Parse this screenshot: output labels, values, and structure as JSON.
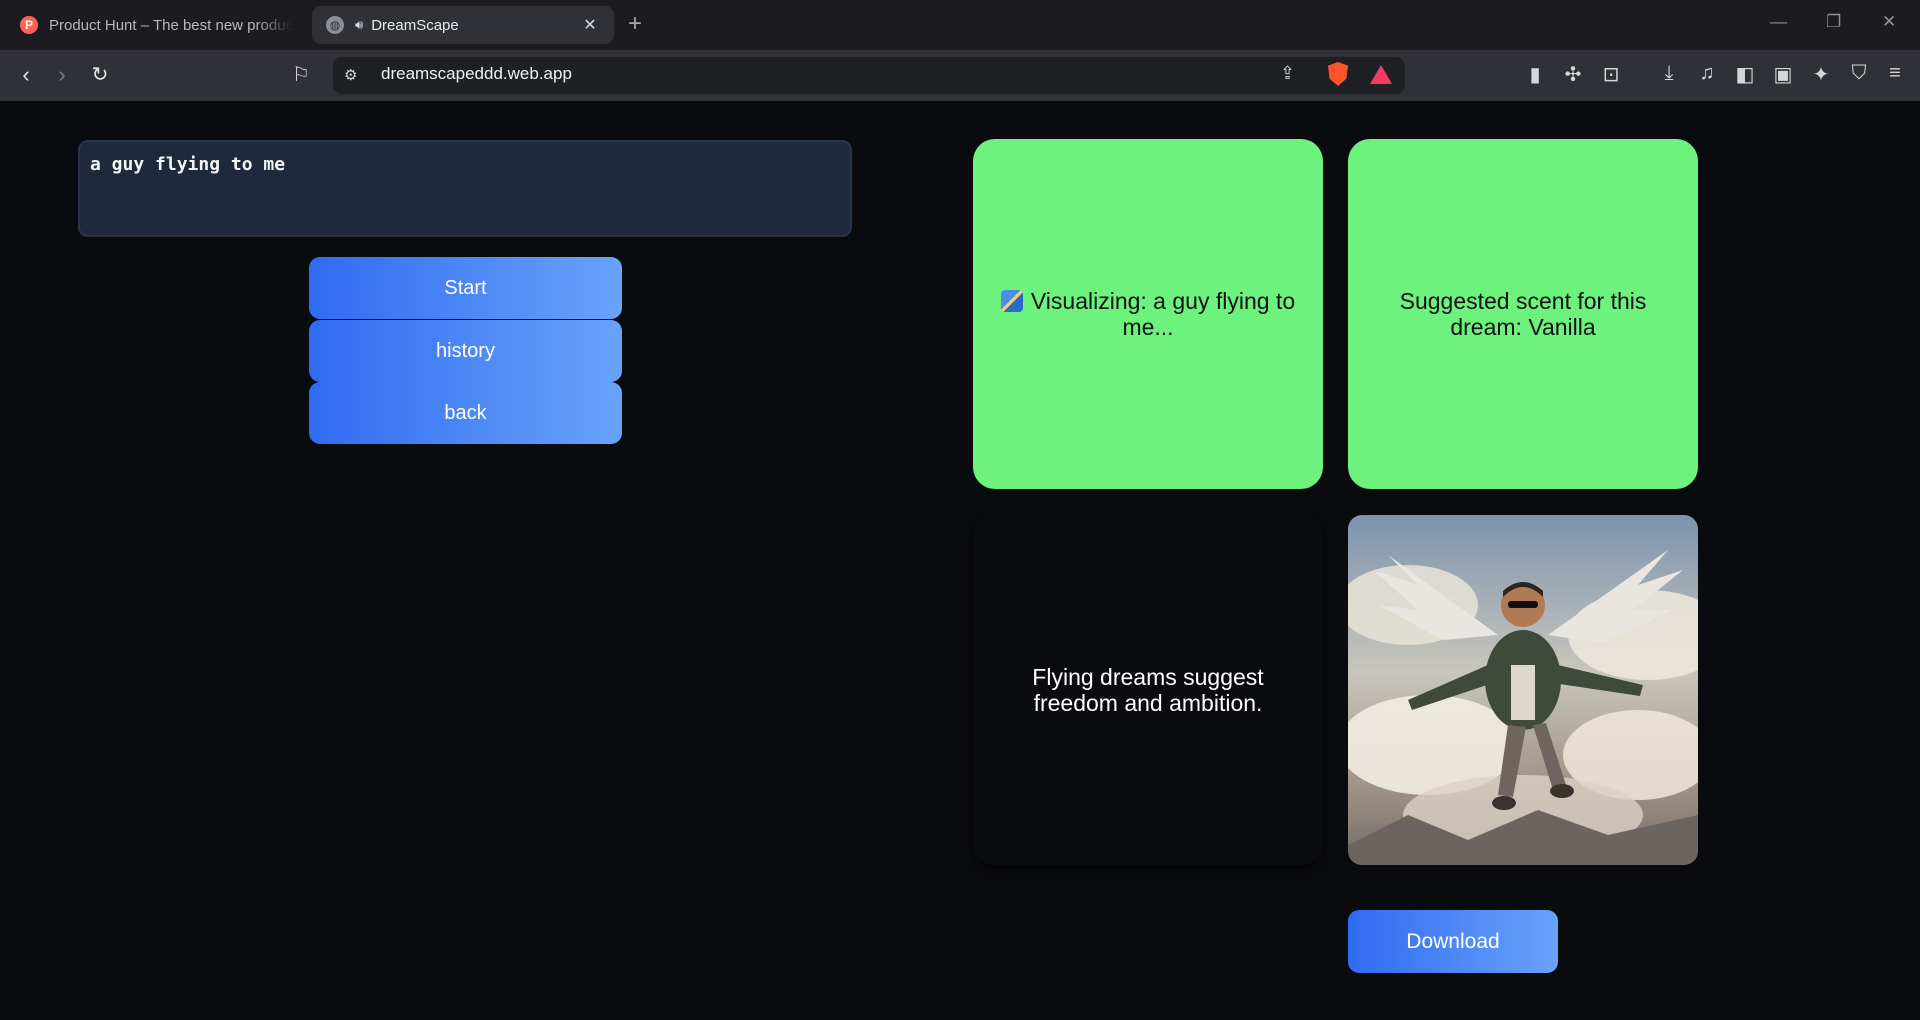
{
  "browser": {
    "tabs": [
      {
        "title": "Product Hunt – The best new products",
        "favicon": "P",
        "active": false
      },
      {
        "title": "DreamScape",
        "active": true
      }
    ],
    "new_tab_symbol": "+",
    "tab_close_symbol": "✕",
    "url": "dreamscapeddd.web.app"
  },
  "input": {
    "value": "a guy flying to me"
  },
  "buttons": {
    "start": "Start",
    "history": "history",
    "back": "back",
    "download": "Download"
  },
  "cards": {
    "visualizing": "Visualizing: a guy flying to me...",
    "scent": "Suggested scent for this dream: Vanilla",
    "interpretation": "Flying dreams suggest freedom and ambition."
  },
  "image": {
    "subject": "flying-man-with-wings"
  },
  "colors": {
    "card_green": "#6cf27d",
    "button_gradient_start": "#2f6bf0",
    "button_gradient_end": "#6aa3fb",
    "input_bg": "#1e293b",
    "page_bg": "#0a0b0e"
  }
}
